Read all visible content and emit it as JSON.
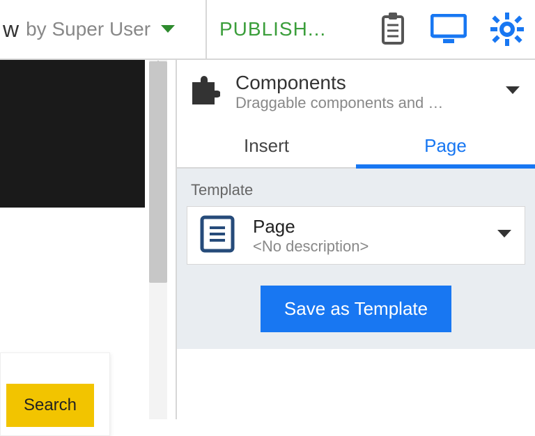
{
  "header": {
    "owner_prefix": "w",
    "owner_label": "by Super User",
    "publish_label": "PUBLISH..."
  },
  "components": {
    "title": "Components",
    "subtitle": "Draggable components and p...",
    "tabs": {
      "insert": "Insert",
      "page": "Page"
    }
  },
  "template_section": {
    "label": "Template",
    "item": {
      "name": "Page",
      "description": "<No description>"
    },
    "save_label": "Save as Template"
  },
  "search": {
    "button_label": "Search"
  },
  "colors": {
    "accent_blue": "#1877f2",
    "accent_green": "#3b9e3b",
    "warn_yellow": "#f2c400"
  }
}
